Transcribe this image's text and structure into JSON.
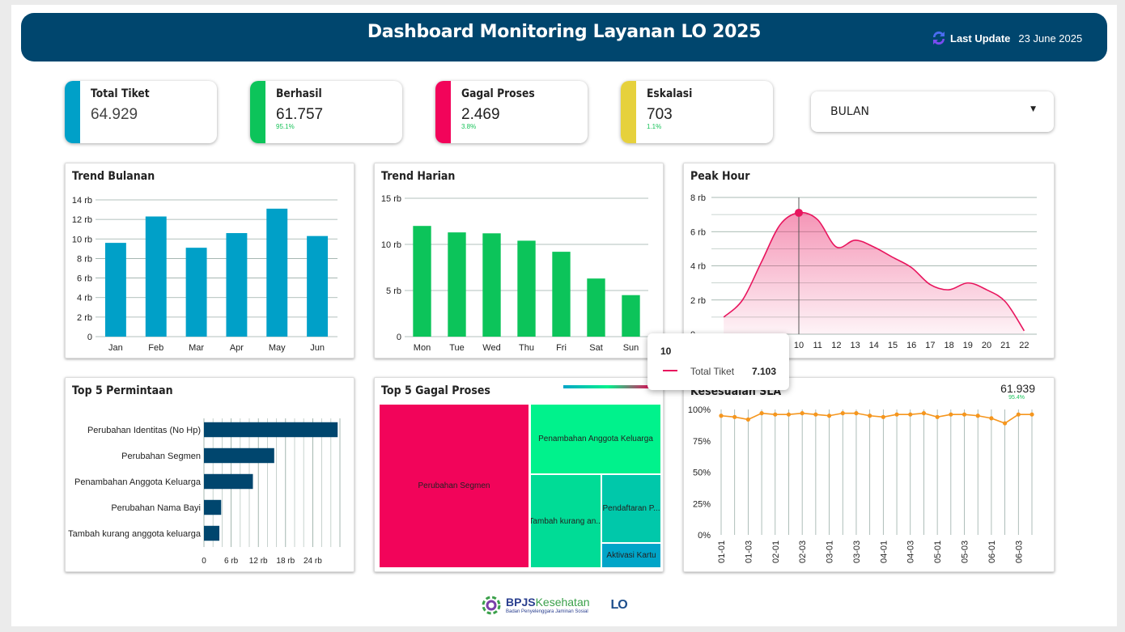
{
  "header": {
    "title": "Dashboard Monitoring Layanan LO 2025",
    "last_update_label": "Last Update",
    "last_update_date": "23 June 2025",
    "icon": "refresh-icon"
  },
  "kpis": [
    {
      "label": "Total Tiket",
      "value": "64.929",
      "pct": "",
      "color": "#00a0c8"
    },
    {
      "label": "Berhasil",
      "value": "61.757",
      "pct": "95.1%",
      "color": "#0cc45a"
    },
    {
      "label": "Gagal Proses",
      "value": "2.469",
      "pct": "3.8%",
      "color": "#f2045a"
    },
    {
      "label": "Eskalasi",
      "value": "703",
      "pct": "1.1%",
      "color": "#e6d13c"
    }
  ],
  "filter": {
    "value": "BULAN"
  },
  "tooltip": {
    "header": "10",
    "series": "Total Tiket",
    "value": "7.103"
  },
  "footer": {
    "brand": "BPJS",
    "brand2": "Kesehatan",
    "tagline": "Badan Penyelenggara Jaminan Sosial",
    "logo2": "LO"
  },
  "chart_data": [
    {
      "id": "trend-bulanan",
      "type": "bar",
      "title": "Trend Bulanan",
      "color": "#00a0c8",
      "categories": [
        "Jan",
        "Feb",
        "Mar",
        "Apr",
        "May",
        "Jun"
      ],
      "values": [
        9600,
        12300,
        9100,
        10600,
        13100,
        10300
      ],
      "ylim": [
        0,
        14000
      ],
      "yticks": [
        "0",
        "2 rb",
        "4 rb",
        "6 rb",
        "8 rb",
        "10 rb",
        "12 rb",
        "14 rb"
      ]
    },
    {
      "id": "trend-harian",
      "type": "bar",
      "title": "Trend Harian",
      "color": "#0cc45a",
      "categories": [
        "Mon",
        "Tue",
        "Wed",
        "Thu",
        "Fri",
        "Sat",
        "Sun"
      ],
      "values": [
        12000,
        11300,
        11200,
        10400,
        9200,
        6300,
        4500
      ],
      "ylim": [
        0,
        15000
      ],
      "yticks": [
        "0",
        "5 rb",
        "10 rb",
        "15 rb"
      ]
    },
    {
      "id": "peak-hour",
      "type": "area",
      "title": "Peak Hour",
      "color": "#e8155e",
      "x": [
        6,
        7,
        8,
        9,
        10,
        11,
        12,
        13,
        14,
        15,
        16,
        17,
        18,
        19,
        20,
        21,
        22
      ],
      "values": [
        1000,
        2000,
        4200,
        6400,
        7103,
        6700,
        5100,
        5500,
        5100,
        4500,
        3900,
        2900,
        2600,
        3000,
        2600,
        1900,
        200
      ],
      "ylim": [
        0,
        8000
      ],
      "yticks": [
        "0",
        "2 rb",
        "4 rb",
        "6 rb",
        "8 rb"
      ],
      "xticks": [
        "10",
        "11",
        "12",
        "13",
        "14",
        "15",
        "16",
        "17",
        "18",
        "19",
        "20",
        "21",
        "22"
      ]
    },
    {
      "id": "top5-permintaan",
      "type": "bar",
      "orientation": "horizontal",
      "title": "Top 5 Permintaan",
      "color": "#00466e",
      "categories": [
        "Perubahan Identitas (No Hp)",
        "Perubahan Segmen",
        "Penambahan Anggota Keluarga",
        "Perubahan Nama Bayi",
        "Tambah kurang anggota keluarga"
      ],
      "values": [
        29500,
        15500,
        10800,
        3800,
        3400
      ],
      "xlim": [
        0,
        30000
      ],
      "xticks": [
        "0",
        "6 rb",
        "12 rb",
        "18 rb",
        "24 rb"
      ]
    },
    {
      "id": "top5-gagal",
      "type": "treemap",
      "title": "Top 5 Gagal Proses",
      "items": [
        {
          "label": "Perubahan Segmen",
          "color": "#f2045a"
        },
        {
          "label": "Penambahan Anggota Keluarga",
          "color": "#00f28c"
        },
        {
          "label": "Tambah kurang an...",
          "color": "#00dc96"
        },
        {
          "label": "Pendaftaran P...",
          "color": "#00c8aa"
        },
        {
          "label": "Aktivasi Kartu",
          "color": "#00a5c8"
        }
      ]
    },
    {
      "id": "kesesuaian-sla",
      "type": "line",
      "title": "Kesesuaian SLA",
      "color": "#f5961e",
      "total": "61.939",
      "total_pct": "95.4%",
      "xticks": [
        "01-01",
        "01-03",
        "02-01",
        "02-03",
        "03-01",
        "03-03",
        "04-01",
        "04-03",
        "05-01",
        "05-03",
        "06-01",
        "06-03"
      ],
      "values": [
        95,
        94,
        92,
        97,
        96,
        96,
        97,
        96,
        95,
        97,
        97,
        95,
        94,
        96,
        96,
        97,
        94,
        96,
        96,
        95,
        93,
        89,
        96,
        96
      ],
      "ylim": [
        0,
        100
      ],
      "yticks": [
        "0%",
        "25%",
        "50%",
        "75%",
        "100%"
      ]
    }
  ]
}
